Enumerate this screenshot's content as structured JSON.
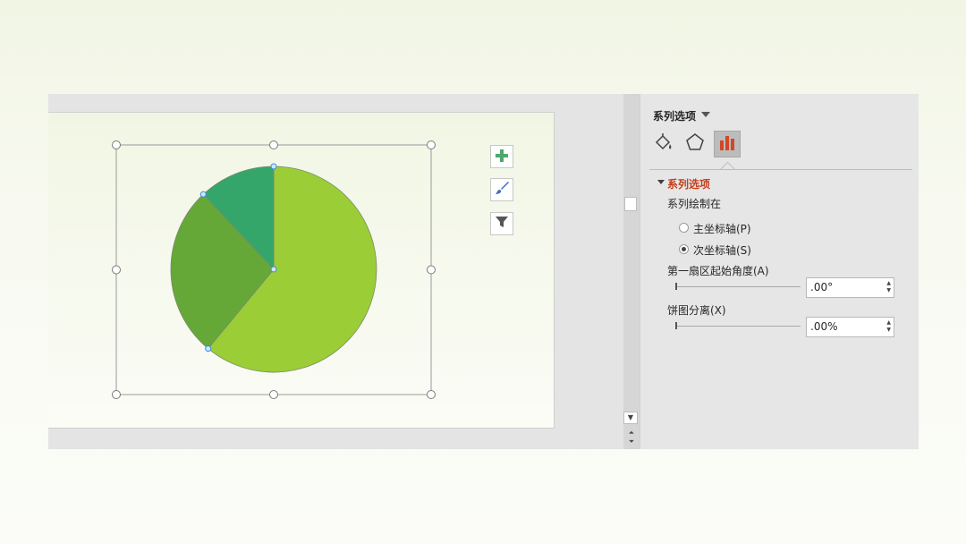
{
  "format_pane": {
    "title": "系列选项",
    "tabs": [
      {
        "icon": "paint-bucket-icon",
        "name": "填充与线条"
      },
      {
        "icon": "pentagon-icon",
        "name": "效果"
      },
      {
        "icon": "bar-chart-icon",
        "name": "系列选项",
        "selected": true
      }
    ],
    "section_title": "系列选项",
    "plot_on_label": "系列绘制在",
    "primary_axis_label": "主坐标轴(P)",
    "secondary_axis_label": "次坐标轴(S)",
    "plot_on_selected": "secondary",
    "first_slice_angle_label": "第一扇区起始角度(A)",
    "first_slice_angle_value": ".00°",
    "explosion_label": "饼图分离(X)",
    "explosion_value": ".00%"
  },
  "chart_tools": [
    {
      "icon": "plus-icon",
      "name": "图表元素"
    },
    {
      "icon": "brush-icon",
      "name": "图表样式"
    },
    {
      "icon": "filter-icon",
      "name": "图表筛选器"
    }
  ],
  "chart_data": {
    "type": "pie",
    "start_angle_deg": 0,
    "series": [
      {
        "values": [
          61,
          27,
          12
        ]
      }
    ],
    "colors": [
      "#9bcd37",
      "#65a838",
      "#35a66a"
    ]
  }
}
